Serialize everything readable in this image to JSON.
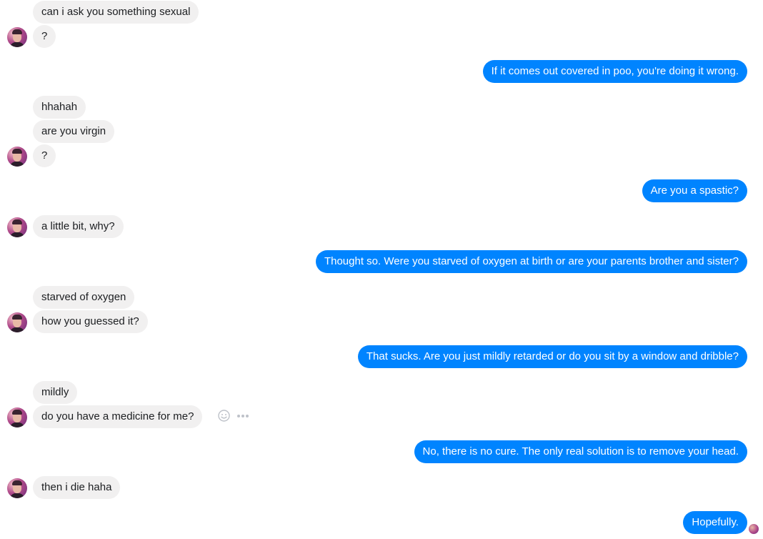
{
  "conversation": {
    "messages": [
      {
        "id": "m1",
        "from": "them",
        "text": "can i ask you something sexual"
      },
      {
        "id": "m2",
        "from": "them",
        "text": "?"
      },
      {
        "id": "m3",
        "from": "me",
        "text": "If it comes out covered in poo, you're doing it wrong."
      },
      {
        "id": "m4",
        "from": "them",
        "text": "hhahah"
      },
      {
        "id": "m5",
        "from": "them",
        "text": "are you virgin"
      },
      {
        "id": "m6",
        "from": "them",
        "text": "?"
      },
      {
        "id": "m7",
        "from": "me",
        "text": "Are you a spastic?"
      },
      {
        "id": "m8",
        "from": "them",
        "text": "a little bit, why?"
      },
      {
        "id": "m9",
        "from": "me",
        "text": "Thought so. Were you starved of oxygen at birth or are your parents brother and sister?"
      },
      {
        "id": "m10",
        "from": "them",
        "text": "starved of oxygen"
      },
      {
        "id": "m11",
        "from": "them",
        "text": "how you guessed it?"
      },
      {
        "id": "m12",
        "from": "me",
        "text": "That sucks. Are you just mildly retarded or do you sit by a window and dribble?"
      },
      {
        "id": "m13",
        "from": "them",
        "text": "mildly"
      },
      {
        "id": "m14",
        "from": "them",
        "text": "do you have a medicine for me?"
      },
      {
        "id": "m15",
        "from": "me",
        "text": "No, there is no cure. The only real solution is to remove your head."
      },
      {
        "id": "m16",
        "from": "them",
        "text": "then i die haha"
      },
      {
        "id": "m17",
        "from": "me",
        "text": "Hopefully."
      }
    ]
  },
  "colors": {
    "outgoing_bubble": "#0084ff",
    "incoming_bubble": "#f1f0f0",
    "icon_gray": "#bec2c9"
  },
  "icons": {
    "emoji": "smiley-face-icon",
    "more": "more-options-icon",
    "avatar": "contact-avatar",
    "read_receipt": "seen-avatar"
  }
}
